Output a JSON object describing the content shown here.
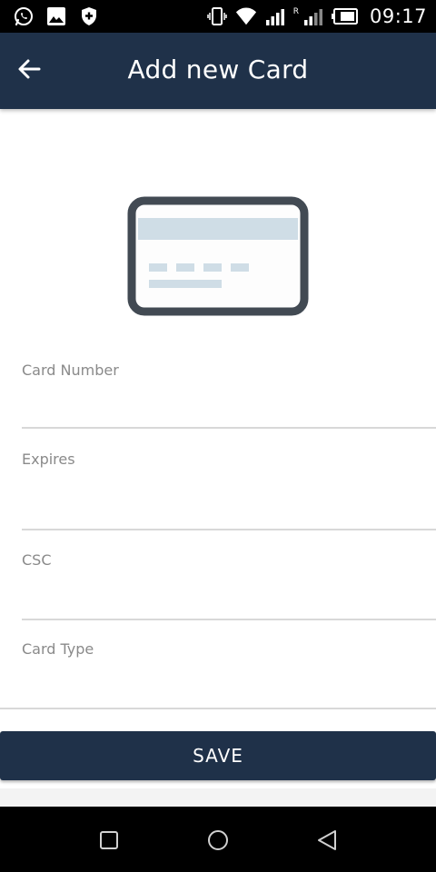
{
  "status_bar": {
    "time": "09:17",
    "roaming_indicator": "R",
    "left_icons": [
      "whatsapp-icon",
      "image-icon",
      "shield-plus-icon"
    ],
    "right_icons": [
      "vibrate-icon",
      "wifi-icon",
      "signal-icon",
      "signal-icon",
      "battery-icon"
    ]
  },
  "app_bar": {
    "title": "Add new Card",
    "back_icon": "arrow-left-icon",
    "background": "#1f3149"
  },
  "illustration": {
    "icon": "credit-card-icon",
    "frame_color": "#424a53",
    "stripe_color": "#cfdde6"
  },
  "form": {
    "card_number": {
      "label": "Card Number",
      "value": ""
    },
    "expires": {
      "label": "Expires",
      "value": ""
    },
    "csc": {
      "label": "CSC",
      "value": ""
    },
    "card_type": {
      "label": "Card Type",
      "value": ""
    }
  },
  "actions": {
    "save_label": "SAVE"
  },
  "nav_bar": {
    "icons": [
      "square-recents-icon",
      "circle-home-icon",
      "triangle-back-icon"
    ]
  },
  "colors": {
    "primary": "#1f3149",
    "label": "#8a8a8a",
    "divider": "#d8d8d8"
  }
}
